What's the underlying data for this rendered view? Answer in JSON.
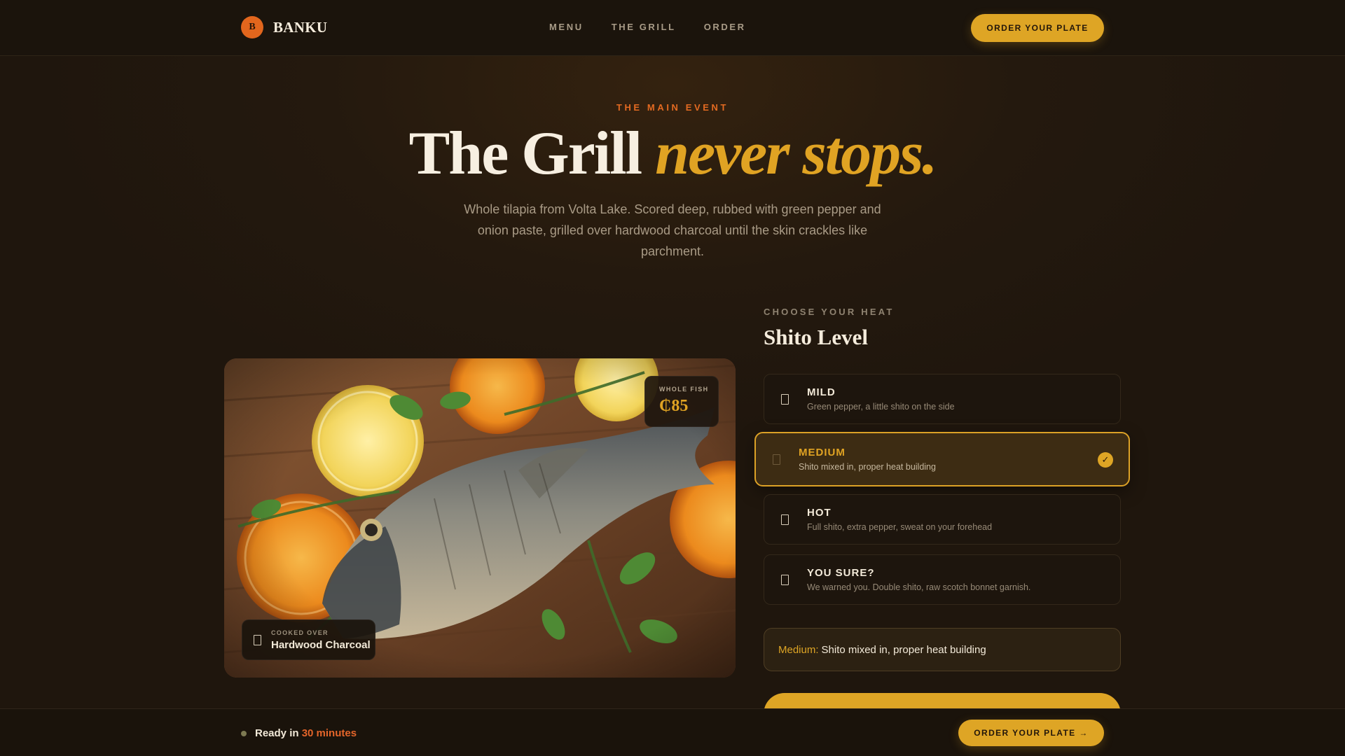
{
  "brand": {
    "mark": "B",
    "name": "BANKU"
  },
  "nav": {
    "items": [
      "MENU",
      "THE GRILL",
      "ORDER"
    ]
  },
  "header": {
    "cta_label": "ORDER YOUR PLATE"
  },
  "hero": {
    "eyebrow": "THE MAIN EVENT",
    "headline_main": "The Grill",
    "headline_accent": "never stops.",
    "lede": "Whole tilapia from Volta Lake. Scored deep, rubbed with green pepper and onion paste, grilled over hardwood charcoal until the skin crackles like parchment."
  },
  "photo": {
    "price_label": "WHOLE FISH",
    "price": "₵85",
    "fuel_label": "COOKED OVER",
    "fuel_value": "Hardwood Charcoal"
  },
  "heat": {
    "eyebrow": "CHOOSE YOUR HEAT",
    "title": "Shito Level",
    "options": [
      {
        "name": "MILD",
        "desc": "Green pepper, a little shito on the side",
        "selected": false
      },
      {
        "name": "MEDIUM",
        "desc": "Shito mixed in, proper heat building",
        "selected": true
      },
      {
        "name": "HOT",
        "desc": "Full shito, extra pepper, sweat on your forehead",
        "selected": false
      },
      {
        "name": "YOU SURE?",
        "desc": "We warned you. Double shito, raw scotch bonnet garnish.",
        "selected": false
      }
    ],
    "summary_label": "Medium:",
    "summary_text": "Shito mixed in, proper heat building"
  },
  "footer_bar": {
    "ready_prefix": "Ready in",
    "ready_time": "30 minutes",
    "cta_label": "ORDER YOUR PLATE →"
  },
  "colors": {
    "accent_gold": "#dea525",
    "accent_orange": "#e2661d",
    "background": "#24190e"
  }
}
